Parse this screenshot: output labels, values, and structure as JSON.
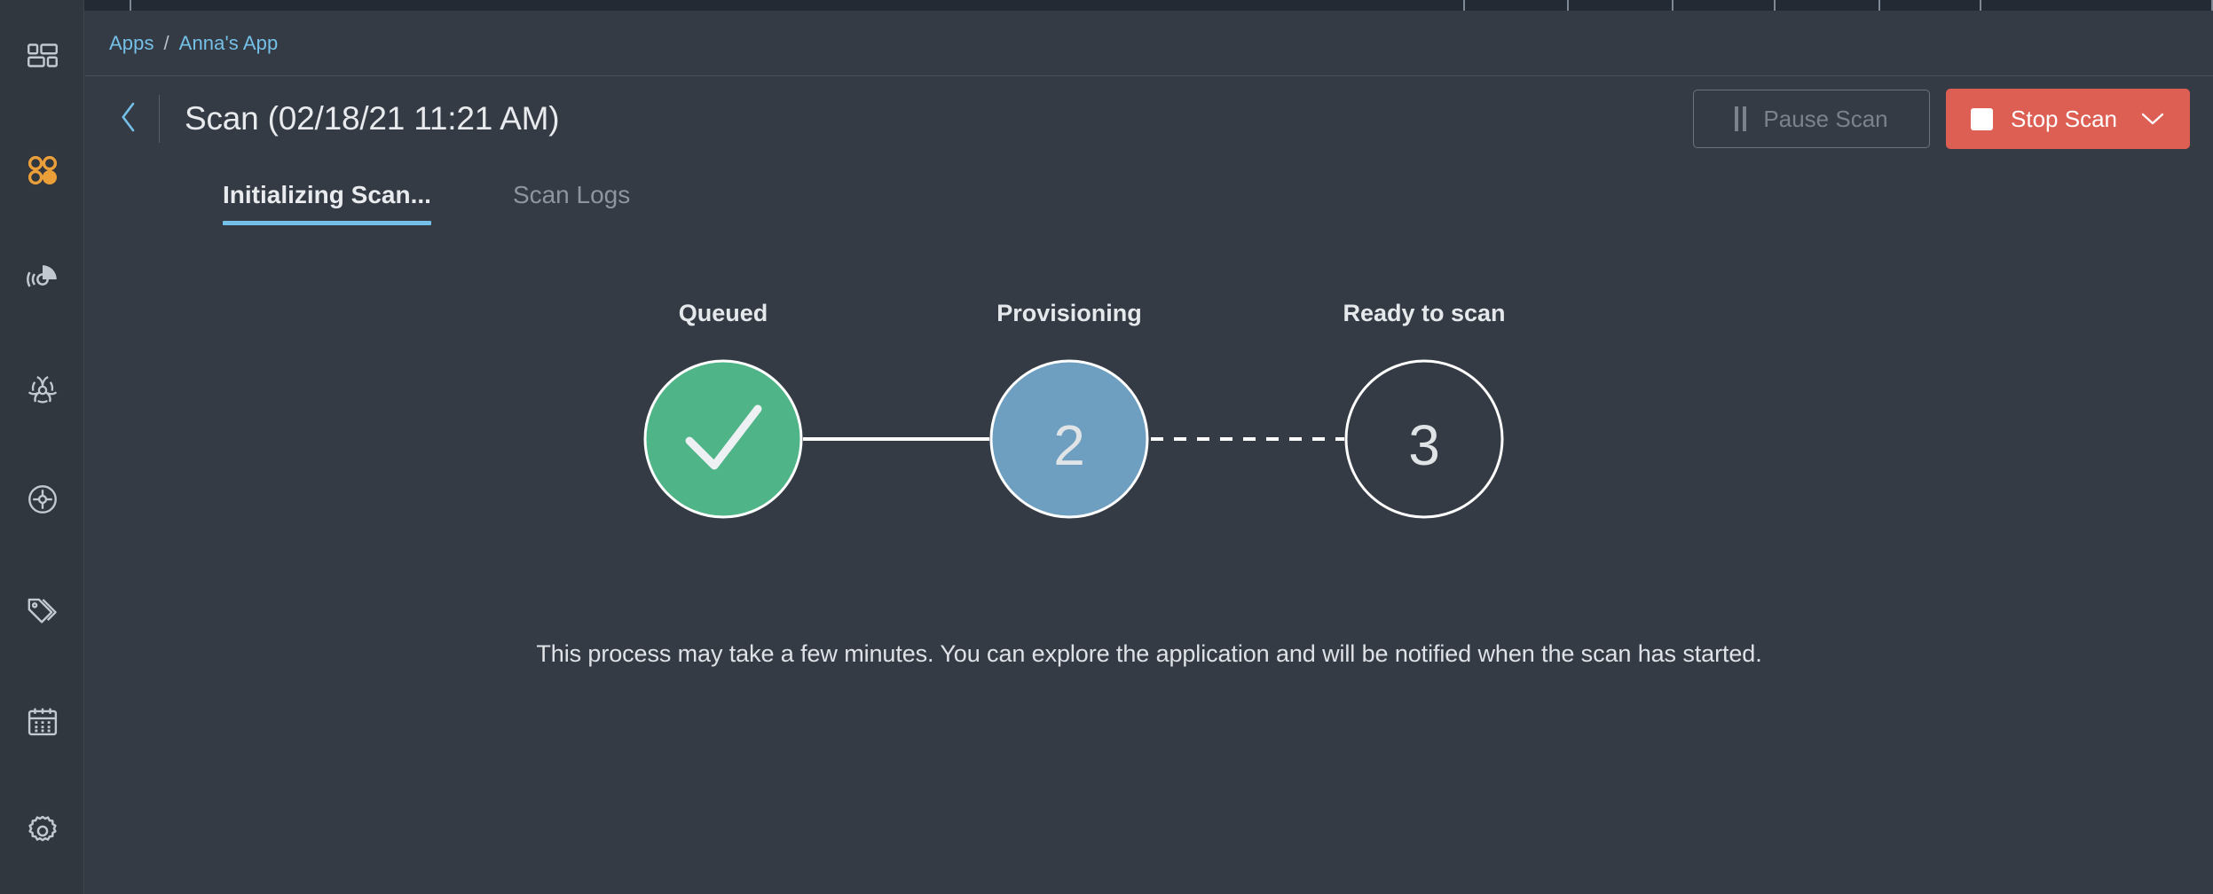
{
  "window": {
    "background_color": "#343b44",
    "sidebar_color": "#31373f",
    "accent_color": "#74c0e8"
  },
  "top_strip": {
    "segment_widths": [
      148,
      1503,
      117,
      118,
      115,
      118,
      114,
      261
    ]
  },
  "sidebar": {
    "items": [
      {
        "name": "dashboard-icon",
        "icon": "dashboard-grid-icon",
        "label": "Dashboard",
        "active": false,
        "color": "#c3c9d1"
      },
      {
        "name": "apps-icon",
        "icon": "apps-dots-icon",
        "label": "Apps",
        "active": true,
        "color": "#eb9f39"
      },
      {
        "name": "scans-icon",
        "icon": "radar-icon",
        "label": "Scans",
        "active": false,
        "color": "#c3c9d1"
      },
      {
        "name": "vulnerabilities-icon",
        "icon": "biohazard-icon",
        "label": "Vulnerabilities",
        "active": false,
        "color": "#c3c9d1"
      },
      {
        "name": "targets-icon",
        "icon": "crosshair-icon",
        "label": "Targets",
        "active": false,
        "color": "#c3c9d1"
      },
      {
        "name": "tags-icon",
        "icon": "tags-icon",
        "label": "Tags",
        "active": false,
        "color": "#c3c9d1"
      },
      {
        "name": "schedule-icon",
        "icon": "calendar-icon",
        "label": "Schedule",
        "active": false,
        "color": "#c3c9d1"
      },
      {
        "name": "settings-icon",
        "icon": "gear-icon",
        "label": "Settings",
        "active": false,
        "color": "#c3c9d1"
      }
    ]
  },
  "breadcrumb": {
    "root": "Apps",
    "separator": "/",
    "current": "Anna's App"
  },
  "header": {
    "back_icon": "chevron-left-icon",
    "title": "Scan (02/18/21 11:21 AM)",
    "pause_button": {
      "label": "Pause Scan",
      "icon": "pause-icon",
      "disabled": true
    },
    "stop_button": {
      "label": "Stop Scan",
      "icon": "stop-square-icon",
      "dropdown_icon": "chevron-down-icon",
      "color": "#dd5e52"
    }
  },
  "tabs": [
    {
      "label": "Initializing Scan...",
      "active": true
    },
    {
      "label": "Scan Logs",
      "active": false
    }
  ],
  "stepper": {
    "steps": [
      {
        "label": "Queued",
        "state": "complete",
        "badge": "check",
        "fill": "#4fb488",
        "text": ""
      },
      {
        "label": "Provisioning",
        "state": "active",
        "badge": "number",
        "fill": "#6e9fc0",
        "text": "2"
      },
      {
        "label": "Ready to scan",
        "state": "pending",
        "badge": "number",
        "fill": "none",
        "text": "3"
      }
    ],
    "connectors": [
      {
        "style": "solid"
      },
      {
        "style": "dashed"
      }
    ]
  },
  "footer": {
    "note": "This process may take a few minutes. You can explore the application and will be notified when the scan has started."
  }
}
